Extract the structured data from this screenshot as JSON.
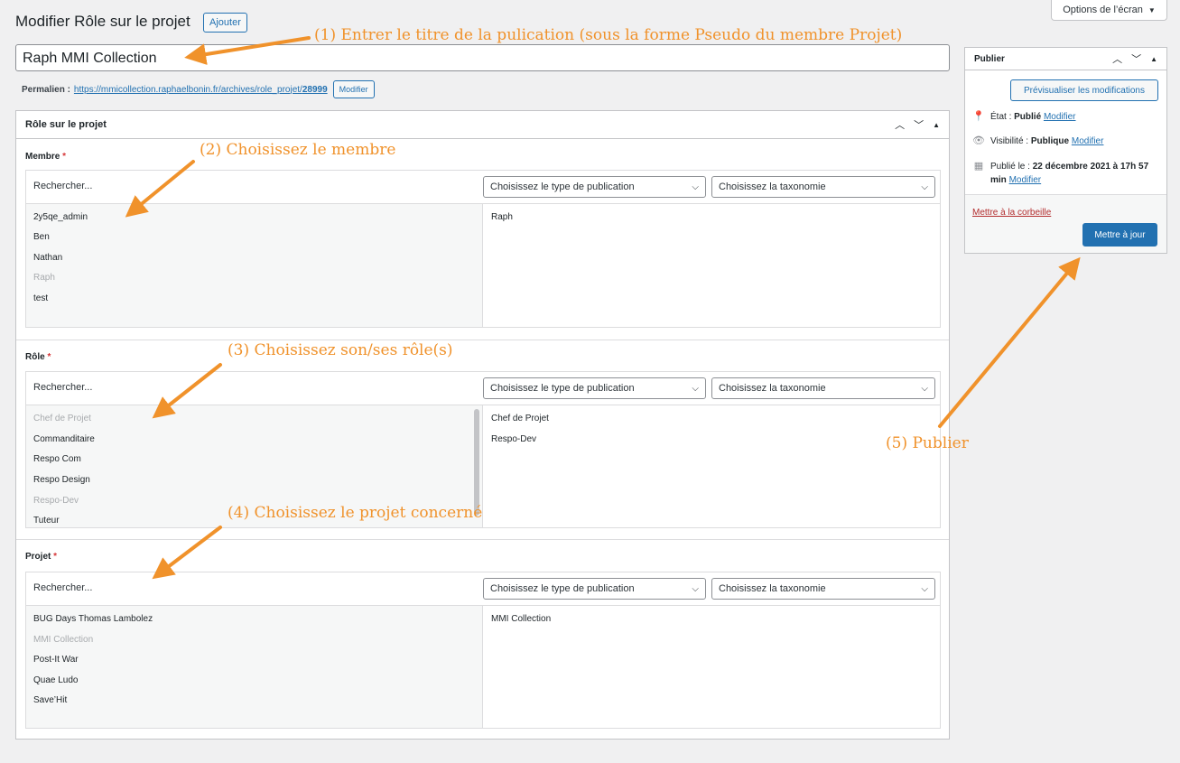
{
  "screen_options": {
    "label": "Options de l’écran"
  },
  "header": {
    "title": "Modifier Rôle sur le projet",
    "add_label": "Ajouter"
  },
  "post_title": {
    "value": "Raph MMI Collection"
  },
  "permalink": {
    "label": "Permalien :",
    "url_base": "https://mmicollection.raphaelbonin.fr/archives/role_projet/",
    "slug": "28999",
    "edit_label": "Modifier"
  },
  "metabox": {
    "title": "Rôle sur le projet",
    "search_placeholder": "Rechercher...",
    "type_select": "Choisissez le type de publication",
    "taxonomy_select": "Choisissez la taxonomie",
    "fields": {
      "membre": {
        "label": "Membre",
        "required": "*",
        "choices": [
          "2y5qe_admin",
          "Ben",
          "Nathan",
          "Raph",
          "test"
        ],
        "values": [
          "Raph"
        ]
      },
      "role": {
        "label": "Rôle",
        "required": "*",
        "choices": [
          "Chef de Projet",
          "Commanditaire",
          "Respo Com",
          "Respo Design",
          "Respo-Dev",
          "Tuteur"
        ],
        "values": [
          "Chef de Projet",
          "Respo-Dev"
        ]
      },
      "projet": {
        "label": "Projet",
        "required": "*",
        "choices": [
          "BUG Days Thomas Lambolez",
          "MMI Collection",
          "Post-It War",
          "Quae Ludo",
          "Save’Hit"
        ],
        "values": [
          "MMI Collection"
        ]
      }
    }
  },
  "publish": {
    "title": "Publier",
    "preview_label": "Prévisualiser les modifications",
    "status_label": "État :",
    "status_value": "Publié",
    "visibility_label": "Visibilité :",
    "visibility_value": "Publique",
    "date_label": "Publié le :",
    "date_value": "22 décembre 2021 à 17h 57 min",
    "edit_link": "Modifier",
    "trash_label": "Mettre à la corbeille",
    "update_label": "Mettre à jour"
  },
  "annotations": {
    "a1": "(1) Entrer le titre de la pulication (sous la forme Pseudo du membre Projet)",
    "a2": "(2) Choisissez le membre",
    "a3": "(3) Choisissez son/ses rôle(s)",
    "a4": "(4) Choisissez le projet concerné",
    "a5": "(5) Publier"
  },
  "colors": {
    "accent": "#2271b1",
    "annotation": "#f0922b",
    "required": "#d63638",
    "trash": "#b32d2e"
  }
}
